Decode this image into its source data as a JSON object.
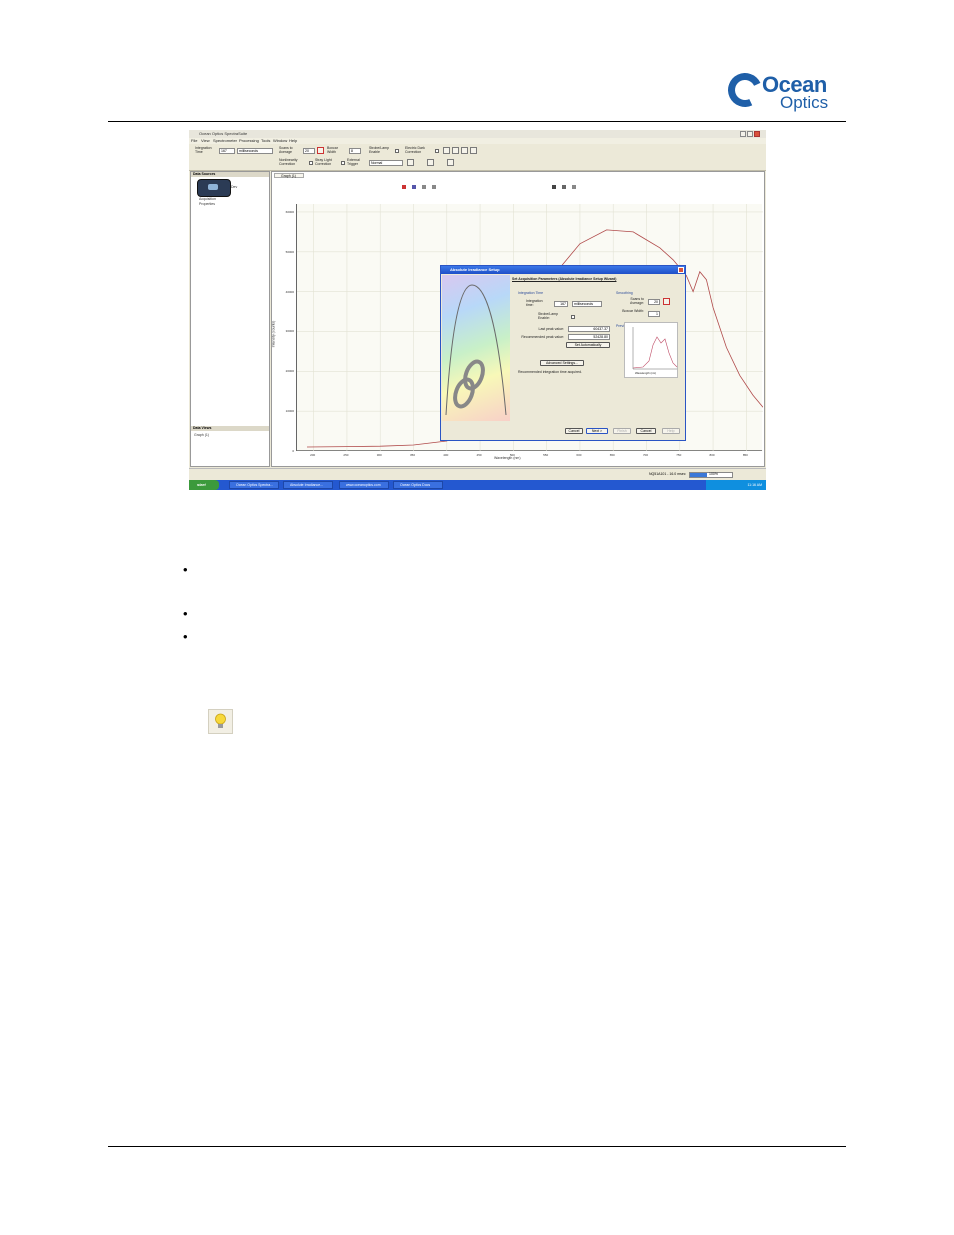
{
  "document": {
    "logo_line1": "Ocean",
    "logo_line2": "Optics",
    "logo_color": "#1f5fa8",
    "bullets": [
      "•",
      "•",
      "•"
    ],
    "tip_icon": "lightbulb-icon"
  },
  "window": {
    "title": "Ocean Optics SpectraSuite",
    "menu": [
      "File",
      "View",
      "Spectrometer",
      "Processing",
      "Tools",
      "Window",
      "Help"
    ],
    "toolbar": {
      "integration_time_label": "Integration Time",
      "integration_time_value": "167",
      "integration_units": "milliseconds",
      "scans_to_average_label": "Scans to Average",
      "scans_to_average_value": "20",
      "boxcar_width_label": "Boxcar Width",
      "boxcar_width_value": "8",
      "strobe_lamp_label": "Strobe/Lamp Enable",
      "electric_dark_label": "Electric Dark Correction",
      "nonlinearity_label": "Nonlinearity Correction",
      "stray_light_label": "Stray Light Correction",
      "external_trigger_label": "External Trigger",
      "trigger_mode_value": "Normal"
    },
    "data_sources_title": "Data Sources",
    "data_sources_items": [
      "Acquisition",
      "Properties"
    ],
    "device_label": "Dev",
    "data_views_title": "Data Views",
    "data_views_items": [
      "Graph (1)"
    ],
    "graph_tab": "Graph (1)",
    "graph_toolbar_icons": [
      "zoom-in-icon",
      "zoom-out-icon",
      "pan-icon",
      "cursor-icon",
      "save-icon",
      "print-icon",
      "copy-icon"
    ],
    "status_text": "NQ51A101 - 16.0 msec",
    "status_progress_text": "100%",
    "taskbar": {
      "start": "start",
      "items": [
        "Ocean Optics Spectra...",
        "Absolute Irradiance...",
        "www.oceanoptics.com",
        "Ocean Optics Docs"
      ],
      "clock": "11:16 AM"
    }
  },
  "dialog": {
    "title": "Absolute Irradiance Setup",
    "heading": "Set Acquisition Parameters (Absolute Irradiance Setup Wizard)",
    "integration_section": "Integration Time",
    "integration_label": "Integration time:",
    "integration_value": "167",
    "integration_units": "milliseconds",
    "strobe_label": "Strobe/Lamp Enable:",
    "last_peak_label": "Last peak value:",
    "last_peak_value": "60437.37",
    "recommended_label": "Recommended peak value:",
    "recommended_value": "52428.80",
    "set_auto_button": "Set Automatically",
    "advanced_button": "Advanced Settings...",
    "status_message": "Recommended integration time acquired.",
    "smoothing_section": "Smoothing",
    "scans_label": "Scans to Average:",
    "scans_value": "20",
    "boxcar_label": "Boxcar Width:",
    "boxcar_value": "1",
    "preview_section": "Preview",
    "preview_xlabel": "Wavelength (nm)",
    "preview_ylabel": "Value",
    "buttons": [
      "Cancel",
      "Next >",
      "Finish",
      "Cancel",
      "Help"
    ]
  },
  "chart_data": {
    "type": "line",
    "title": "",
    "xlabel": "Wavelength (nm)",
    "ylabel": "Intensity (counts)",
    "x_ticks": [
      "200",
      "250",
      "300",
      "350",
      "400",
      "450",
      "500",
      "550",
      "600",
      "650",
      "700",
      "750",
      "800",
      "850"
    ],
    "y_ticks": [
      "0",
      "10000",
      "20000",
      "30000",
      "40000",
      "50000",
      "60000"
    ],
    "xlim": [
      175,
      875
    ],
    "ylim": [
      0,
      62000
    ],
    "series": [
      {
        "color": "#b04a4a",
        "x": [
          190,
          250,
          300,
          350,
          400,
          440,
          460,
          480,
          500,
          520,
          540,
          560,
          600,
          640,
          680,
          700,
          720,
          740,
          760,
          770,
          780,
          790,
          800,
          820,
          840,
          860,
          875
        ],
        "y": [
          1000,
          1100,
          1200,
          1500,
          2500,
          6000,
          9000,
          14000,
          21000,
          29000,
          37000,
          44000,
          52000,
          55500,
          55000,
          53000,
          51000,
          48000,
          44000,
          40000,
          45000,
          43000,
          36000,
          26000,
          19000,
          14000,
          11000
        ]
      }
    ]
  }
}
